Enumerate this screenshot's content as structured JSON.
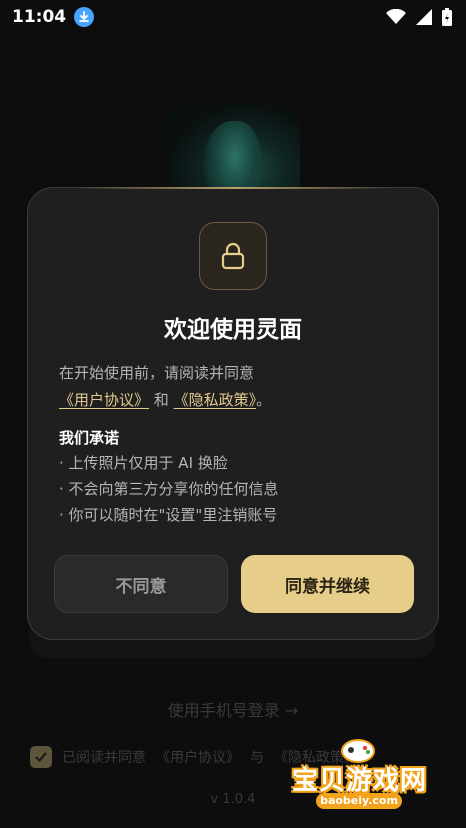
{
  "status": {
    "time": "11:04"
  },
  "dialog": {
    "title": "欢迎使用灵面",
    "intro_text": "在开始使用前，请阅读并同意",
    "user_agreement": "《用户协议》",
    "and_text": "和",
    "privacy_policy": "《隐私政策》",
    "period": "。",
    "promise_title": "我们承诺",
    "promises": [
      "· 上传照片仅用于 AI 换脸",
      "· 不会向第三方分享你的任何信息",
      "· 你可以随时在\"设置\"里注销账号"
    ],
    "decline_label": "不同意",
    "accept_label": "同意并继续"
  },
  "background": {
    "phone_login": "使用手机号登录 →",
    "agree_prefix": "已阅读并同意",
    "agree_user_agreement": "《用户协议》",
    "agree_and": "与",
    "agree_privacy": "《隐私政策》",
    "version": "v 1.0.4"
  },
  "watermark": {
    "title": "宝贝游戏网",
    "domain": "baobeiy.com"
  },
  "colors": {
    "accent": "#e6cd8a",
    "link": "#e2c98f",
    "dialog_bg": "#1f1f1f"
  }
}
